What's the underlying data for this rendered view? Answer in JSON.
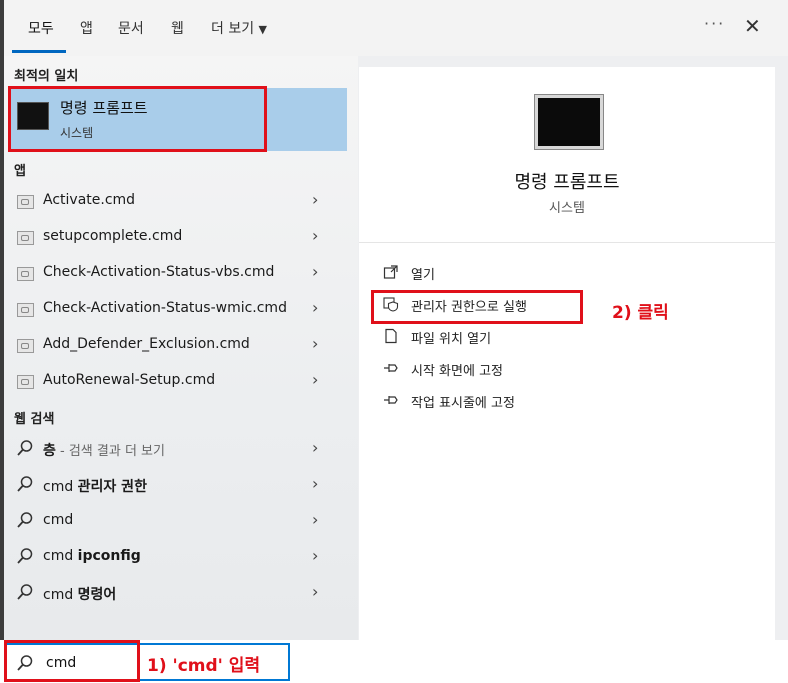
{
  "tabs": [
    {
      "label": "모두",
      "active": true
    },
    {
      "label": "앱"
    },
    {
      "label": "문서"
    },
    {
      "label": "웹"
    },
    {
      "label": "더 보기"
    }
  ],
  "header": {
    "more_label": "···",
    "close_label": "✕"
  },
  "best_match": {
    "section": "최적의 일치",
    "title": "명령 프롬프트",
    "subtitle": "시스템"
  },
  "apps": {
    "section": "앱",
    "items": [
      "Activate.cmd",
      "setupcomplete.cmd",
      "Check-Activation-Status-vbs.cmd",
      "Check-Activation-Status-wmic.cmd",
      "Add_Defender_Exclusion.cmd",
      "AutoRenewal-Setup.cmd"
    ]
  },
  "web": {
    "section": "웹 검색",
    "items": [
      {
        "prefix": "",
        "bold": "층",
        "suffix": " - 검색 결과 더 보기"
      },
      {
        "prefix": "cmd ",
        "bold": "관리자 권한",
        "suffix": ""
      },
      {
        "prefix": "cmd",
        "bold": "",
        "suffix": ""
      },
      {
        "prefix": "cmd ",
        "bold": "ipconfig",
        "suffix": ""
      },
      {
        "prefix": "cmd ",
        "bold": "명령어",
        "suffix": ""
      }
    ]
  },
  "preview": {
    "title": "명령 프롬프트",
    "subtitle": "시스템",
    "actions": [
      {
        "label": "열기",
        "icon": "open-icon"
      },
      {
        "label": "관리자 권한으로 실행",
        "icon": "shield-icon"
      },
      {
        "label": "파일 위치 열기",
        "icon": "file-icon"
      },
      {
        "label": "시작 화면에 고정",
        "icon": "pin-icon"
      },
      {
        "label": "작업 표시줄에 고정",
        "icon": "pin-icon"
      }
    ]
  },
  "search": {
    "value": "cmd"
  },
  "annotations": {
    "step1": "1) 'cmd' 입력",
    "step2": "2) 클릭"
  },
  "colors": {
    "accent": "#0078d4",
    "highlight": "#a9cdea",
    "annotation": "#e0101a"
  }
}
